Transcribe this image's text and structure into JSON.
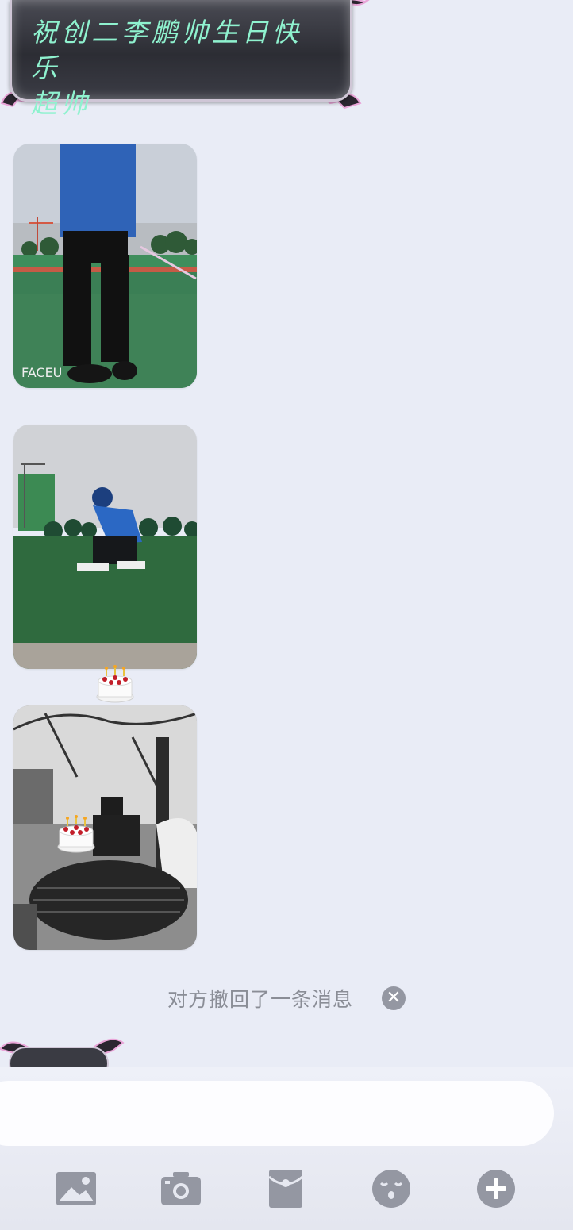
{
  "message_bubble": {
    "text": "祝创二李鹏帅生日快乐\n超帅"
  },
  "photos": [
    {
      "name": "photo-standing-on-field"
    },
    {
      "name": "photo-crouching-on-field"
    },
    {
      "name": "photo-sitting-by-table"
    }
  ],
  "emoji": {
    "name": "birthday-cake",
    "glyph": "🎂"
  },
  "system_notice": {
    "text": "对方撤回了一条消息"
  },
  "input": {
    "value": "",
    "placeholder": ""
  },
  "toolbar": {
    "icons": [
      "image-icon",
      "camera-icon",
      "red-packet-icon",
      "emoji-face-icon",
      "plus-icon"
    ]
  },
  "colors": {
    "chat_background": "#e9ecf6",
    "bubble_text": "#8ff2cf",
    "bubble_background": "#2c2d34",
    "icon_gray": "#9497a2"
  }
}
